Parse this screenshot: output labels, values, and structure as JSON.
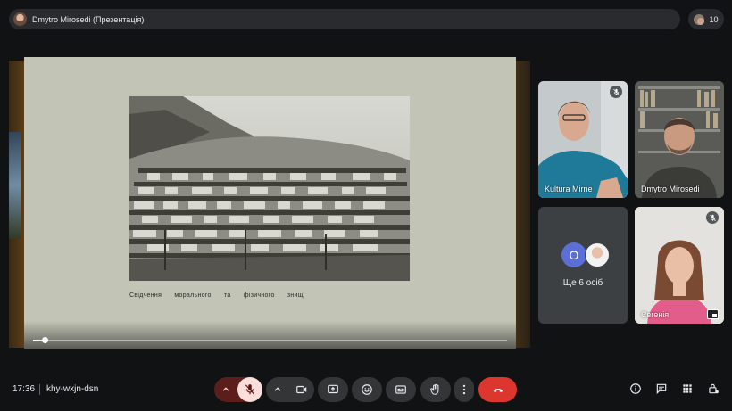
{
  "header": {
    "title": "Dmytro Mirosedi (Презентація)",
    "participant_count": "10"
  },
  "presentation": {
    "caption": "Свідчення морального та фізичного знищ",
    "progress": 0.025
  },
  "participants": [
    {
      "name": "Kultura Mirne",
      "muted": true
    },
    {
      "name": "Dmytro Mirosedi",
      "muted": false
    },
    {
      "name": "Євгенія",
      "muted": true
    }
  ],
  "more_tile": {
    "initial": "O",
    "label": "Ще 6 осіб"
  },
  "footer": {
    "time": "17:36",
    "meeting_code": "khy-wxjn-dsn"
  },
  "colors": {
    "end_call": "#dc362e",
    "mic_muted_bg": "#5c1e1b",
    "avatar_accent": "#5b6fd6"
  },
  "icons": [
    "mic-off-icon",
    "camera-icon",
    "present-icon",
    "emoji-icon",
    "captions-icon",
    "raise-hand-icon",
    "more-vert-icon",
    "end-call-icon",
    "info-icon",
    "chat-icon",
    "activities-icon",
    "host-controls-icon"
  ]
}
